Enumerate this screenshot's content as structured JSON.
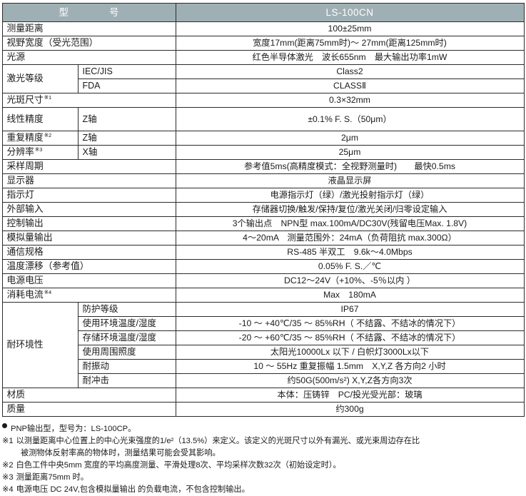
{
  "table": {
    "header": {
      "col_label": "型　　号",
      "col_value": "LS-100CN"
    },
    "rows": [
      {
        "label": "测量距离",
        "label_mark": "",
        "sub": null,
        "value": "100±25mm"
      },
      {
        "label": "视野宽度（受光范围）",
        "label_mark": "",
        "sub": null,
        "value": "宽度17mm(距离75mm时)～ 27mm(距离125mm时)"
      },
      {
        "label": "光源",
        "label_mark": "",
        "sub": null,
        "value": "红色半导体激光　波长655nm　最大输出功率1mW"
      },
      {
        "label": "激光等级",
        "label_mark": "",
        "sub": "IEC/JIS",
        "value": "Class2",
        "rowspan": 2
      },
      {
        "label": "",
        "label_mark": "",
        "sub": "FDA",
        "value": "CLASSⅡ"
      },
      {
        "label": "光斑尺寸",
        "label_mark": "※1",
        "sub": null,
        "value": "0.3×32mm"
      },
      {
        "label": "线性精度",
        "label_mark": "",
        "sub": "Z轴",
        "value": "±0.1% F. S.（50μm）",
        "tall": true
      },
      {
        "label": "重复精度",
        "label_mark": "※2",
        "sub": "Z轴",
        "value": "2μm"
      },
      {
        "label": "分辨率",
        "label_mark": "※3",
        "sub": "X轴",
        "value": "25μm"
      },
      {
        "label": "采样周期",
        "label_mark": "",
        "sub": null,
        "value": "参考值5ms(高精度模式：全视野测量时)　　最快0.5ms"
      },
      {
        "label": "显示器",
        "label_mark": "",
        "sub": null,
        "value": "液晶显示屏"
      },
      {
        "label": "指示灯",
        "label_mark": "",
        "sub": null,
        "value": "电源指示灯（绿）/激光投射指示灯（绿）"
      },
      {
        "label": "外部输入",
        "label_mark": "",
        "sub": null,
        "value": "存储器切换/触发/保持/复位/激光关闭/归零设定输入"
      },
      {
        "label": "控制输出",
        "label_mark": "",
        "sub": null,
        "value": "3个输出点　NPN型 max.100mA/DC30V(残留电压Max. 1.8V)"
      },
      {
        "label": "模拟量输出",
        "label_mark": "",
        "sub": null,
        "value": "4～20mA　测量范围外：24mA（负荷阻抗 max.300Ω）"
      },
      {
        "label": "通信规格",
        "label_mark": "",
        "sub": null,
        "value": "RS-485 半双工　9.6k～4.0Mbps"
      },
      {
        "label": "温度漂移（参考值）",
        "label_mark": "",
        "sub": null,
        "value": "0.05% F. S.／℃"
      },
      {
        "label": "电源电压",
        "label_mark": "",
        "sub": null,
        "value": "DC12～24V（+10%、-5％以内 ）"
      },
      {
        "label": "消耗电流",
        "label_mark": "※4",
        "sub": null,
        "value": "Max　180mA"
      }
    ],
    "environment": {
      "label": "耐环境性",
      "rows": [
        {
          "sub": "防护等级",
          "value": "IP67"
        },
        {
          "sub": "使用环境温度/湿度",
          "value": "-10 ～ +40℃/35 ～ 85%RH（ 不结露、不结冰的情况下）"
        },
        {
          "sub": "存储环境温度/湿度",
          "value": "-20 ～ +60℃/35 ～ 85%RH（ 不结露、不结冰的情况下）"
        },
        {
          "sub": "使用周围照度",
          "value": "太阳光10000Lx 以下 / 白帜灯3000Lx以下"
        },
        {
          "sub": "耐振动",
          "value": "10 ～ 55Hz 重复振幅 1.5mm　X,Y,Z 各方向2 小时"
        },
        {
          "sub": "耐冲击",
          "value": "约50G(500m/s²) X,Y,Z各方向3次"
        }
      ]
    },
    "tail_rows": [
      {
        "label": "材质",
        "value": "本体：压铸锌　PC/投光受光部：玻璃"
      },
      {
        "label": "质量",
        "value": "约300g"
      }
    ]
  },
  "notes": {
    "bullet": "PNP输出型，型号为：LS-100CP。",
    "items": [
      {
        "mark": "※1",
        "line1": "以测量距离中心位置上的中心光束强度的1/e²（13.5%）来定义。该定义的光斑尺寸以外有漏光、或光束周边存在比",
        "line2": "被测物体反射率高的物体时，测量结果可能会受其影响。"
      },
      {
        "mark": "※2",
        "line1": "白色工件中央5mm 宽度的平均高度测量、平滑处理8次、平均采样次数32次（初始设定时）。",
        "line2": ""
      },
      {
        "mark": "※3",
        "line1": "测量距离75mm 时。",
        "line2": ""
      },
      {
        "mark": "※4",
        "line1": "电源电压 DC 24V,包含模拟量输出 的负载电流，不包含控制输出。",
        "line2": ""
      }
    ]
  },
  "colors": {
    "header_bg": "#9fb0b4",
    "header_text": "#ffffff",
    "border": "#2b2b2b",
    "text": "#1a1a1a"
  }
}
